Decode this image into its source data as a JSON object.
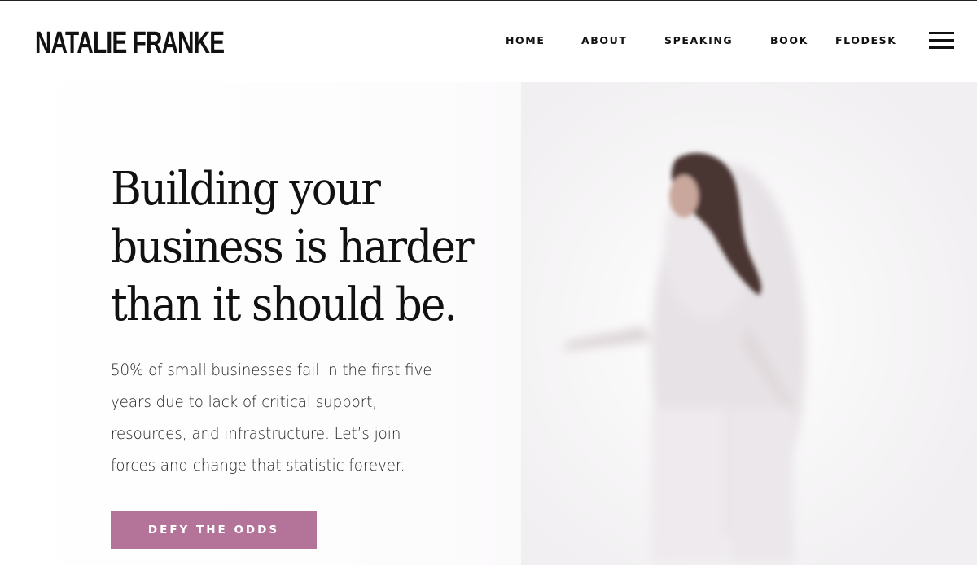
{
  "header": {
    "logo_text": "NATALIE FRANKE",
    "nav": {
      "home": "HOME",
      "about": "ABOUT",
      "speaking": "SPEAKING",
      "book": "BOOK",
      "flodesk": "FLODESK"
    },
    "menu_icon": "hamburger-menu-icon"
  },
  "hero": {
    "title_line1": "Building your",
    "title_line2": "business is harder",
    "title_line3": "than it should be.",
    "body_line1": "50% of small businesses fail in the first five",
    "body_line2": "years due to lack of critical support,",
    "body_line3": "resources, and infrastructure. Let’s join",
    "body_line4": "forces and change that statistic forever.",
    "cta_label": "DEFY THE ODDS"
  },
  "colors": {
    "accent": "#b47398",
    "text": "#111111",
    "background": "#ffffff"
  }
}
